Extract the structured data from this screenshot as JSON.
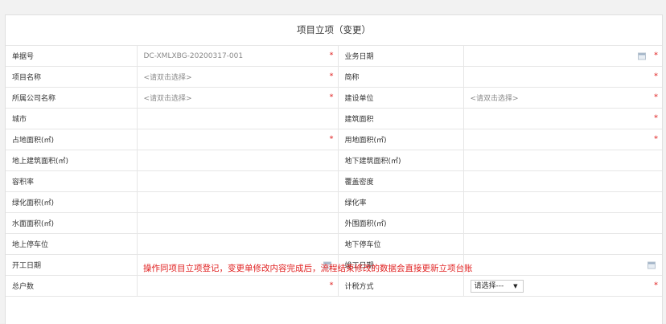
{
  "form": {
    "title": "项目立项（变更）",
    "rows": [
      {
        "l1": "单据号",
        "v1": "DC-XMLXBG-20200317-001",
        "l2": "业务日期",
        "v2": ""
      },
      {
        "l1": "项目名称",
        "v1": "<请双击选择>",
        "l2": "简称",
        "v2": ""
      },
      {
        "l1": "所属公司名称",
        "v1": "<请双击选择>",
        "l2": "建设单位",
        "v2": "<请双击选择>"
      },
      {
        "l1": "城市",
        "v1": "",
        "l2": "建筑面积",
        "v2": ""
      },
      {
        "l1": "占地面积(㎡)",
        "v1": "",
        "l2": "用地面积(㎡)",
        "v2": ""
      },
      {
        "l1": "地上建筑面积(㎡)",
        "v1": "",
        "l2": "地下建筑面积(㎡)",
        "v2": ""
      },
      {
        "l1": "容积率",
        "v1": "",
        "l2": "覆盖密度",
        "v2": ""
      },
      {
        "l1": "绿化面积(㎡)",
        "v1": "",
        "l2": "绿化率",
        "v2": ""
      },
      {
        "l1": "水面面积(㎡)",
        "v1": "",
        "l2": "外围面积(㎡)",
        "v2": ""
      },
      {
        "l1": "地上停车位",
        "v1": "",
        "l2": "地下停车位",
        "v2": ""
      },
      {
        "l1": "开工日期",
        "v1": "",
        "l2": "竣工日期",
        "v2": ""
      },
      {
        "l1": "总户数",
        "v1": "",
        "l2": "计税方式",
        "v2": "请选择---"
      }
    ],
    "required_mark": "*",
    "select_arrow": "▼"
  },
  "notice": "操作同项目立项登记，变更单修改内容完成后，流程结束修改的数据会直接更新立项台账",
  "colors": {
    "required": "#e02020",
    "notice": "#e02020",
    "border": "#e6e6e6"
  }
}
